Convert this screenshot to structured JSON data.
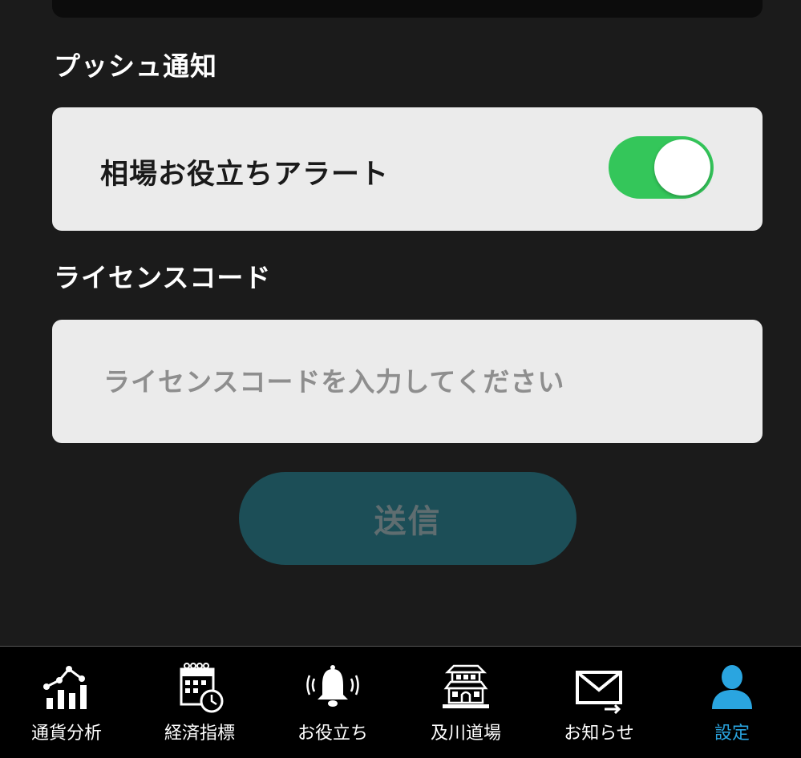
{
  "push_section": {
    "title": "プッシュ通知",
    "alert_label": "相場お役立ちアラート",
    "alert_enabled": true,
    "toggle_color": "#34c65a"
  },
  "license_section": {
    "title": "ライセンスコード",
    "input_value": "",
    "input_placeholder": "ライセンスコードを入力してください"
  },
  "send_button": {
    "label": "送信",
    "enabled": false,
    "color": "#1c4e57"
  },
  "tab_bar": {
    "active_color": "#2aa5e0",
    "tabs": [
      {
        "label": "通貨分析",
        "icon": "bar-chart-trend-icon",
        "active": false
      },
      {
        "label": "経済指標",
        "icon": "calendar-clock-icon",
        "active": false
      },
      {
        "label": "お役立ち",
        "icon": "ringing-bell-icon",
        "active": false
      },
      {
        "label": "及川道場",
        "icon": "dojo-building-icon",
        "active": false
      },
      {
        "label": "お知らせ",
        "icon": "envelope-icon",
        "active": false
      },
      {
        "label": "設定",
        "icon": "user-icon",
        "active": true
      }
    ]
  }
}
